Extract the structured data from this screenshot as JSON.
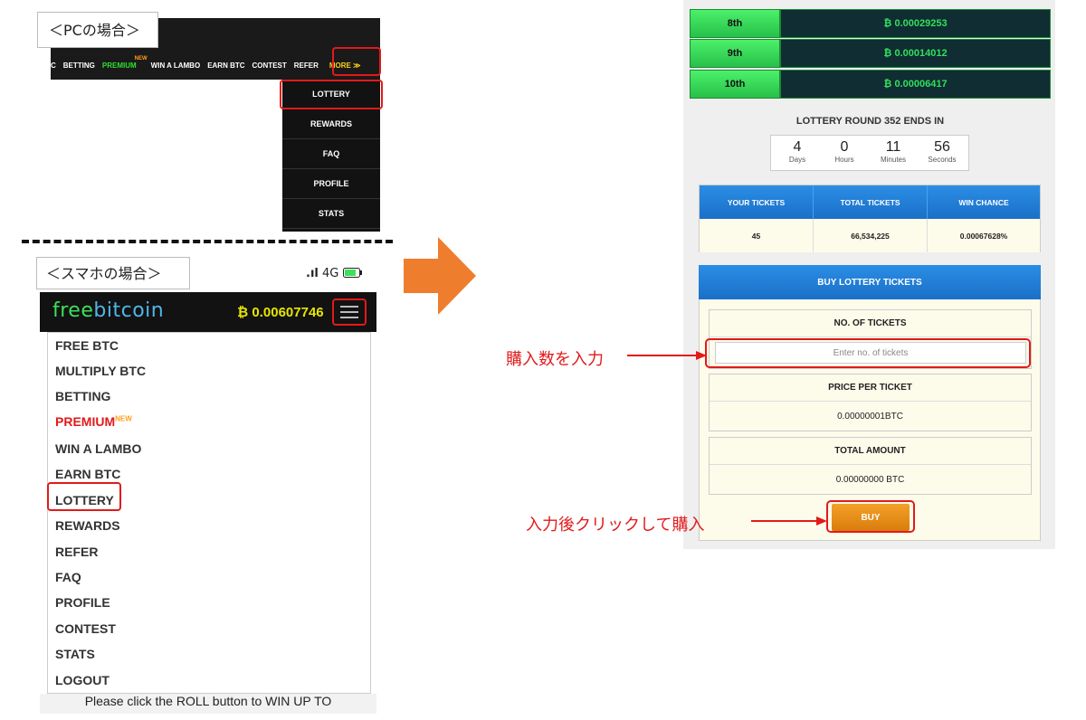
{
  "pc_panel": {
    "label": "＜PCの場合＞",
    "nav_items": [
      "C",
      "BETTING",
      "PREMIUM",
      "WIN A LAMBO",
      "EARN BTC",
      "CONTEST",
      "REFER",
      "MORE ≫"
    ],
    "premium_badge": "NEW",
    "dropdown_items": [
      "LOTTERY",
      "REWARDS",
      "FAQ",
      "PROFILE",
      "STATS"
    ]
  },
  "mobile_panel": {
    "label": "＜スマホの場合＞",
    "signal": "4G",
    "logo_free": "free",
    "logo_bitcoin": "bitcoin",
    "balance": "₿ 0.00607746",
    "menu_items": [
      "FREE BTC",
      "MULTIPLY BTC",
      "BETTING",
      "PREMIUM",
      "WIN A LAMBO",
      "EARN BTC",
      "LOTTERY",
      "REWARDS",
      "REFER",
      "FAQ",
      "PROFILE",
      "CONTEST",
      "STATS",
      "LOGOUT"
    ],
    "premium_badge": "NEW",
    "footer_text": "Please click the ROLL button to WIN UP TO"
  },
  "lottery": {
    "ranks": [
      {
        "rank": "8th",
        "prize": "₿ 0.00029253"
      },
      {
        "rank": "9th",
        "prize": "₿ 0.00014012"
      },
      {
        "rank": "10th",
        "prize": "₿ 0.00006417"
      }
    ],
    "round_title": "LOTTERY ROUND 352 ENDS IN",
    "countdown": [
      {
        "value": "4",
        "unit": "Days"
      },
      {
        "value": "0",
        "unit": "Hours"
      },
      {
        "value": "11",
        "unit": "Minutes"
      },
      {
        "value": "56",
        "unit": "Seconds"
      }
    ],
    "stats_headers": [
      "YOUR TICKETS",
      "TOTAL TICKETS",
      "WIN CHANCE"
    ],
    "stats_values": [
      "45",
      "66,534,225",
      "0.00067628%"
    ],
    "buy_title": "BUY LOTTERY TICKETS",
    "no_of_tickets_label": "NO. OF TICKETS",
    "tickets_placeholder": "Enter no. of tickets",
    "price_label": "PRICE PER TICKET",
    "price_value": "0.00000001BTC",
    "total_label": "TOTAL AMOUNT",
    "total_value": "0.00000000 BTC",
    "buy_button": "BUY"
  },
  "annotations": {
    "input_note": "購入数を入力",
    "buy_note": "入力後クリックして購入"
  },
  "colors": {
    "highlight_red": "#e21a1a",
    "accent_green": "#32e05a",
    "accent_blue": "#1a70c8",
    "arrow_orange": "#ee7e2d"
  }
}
